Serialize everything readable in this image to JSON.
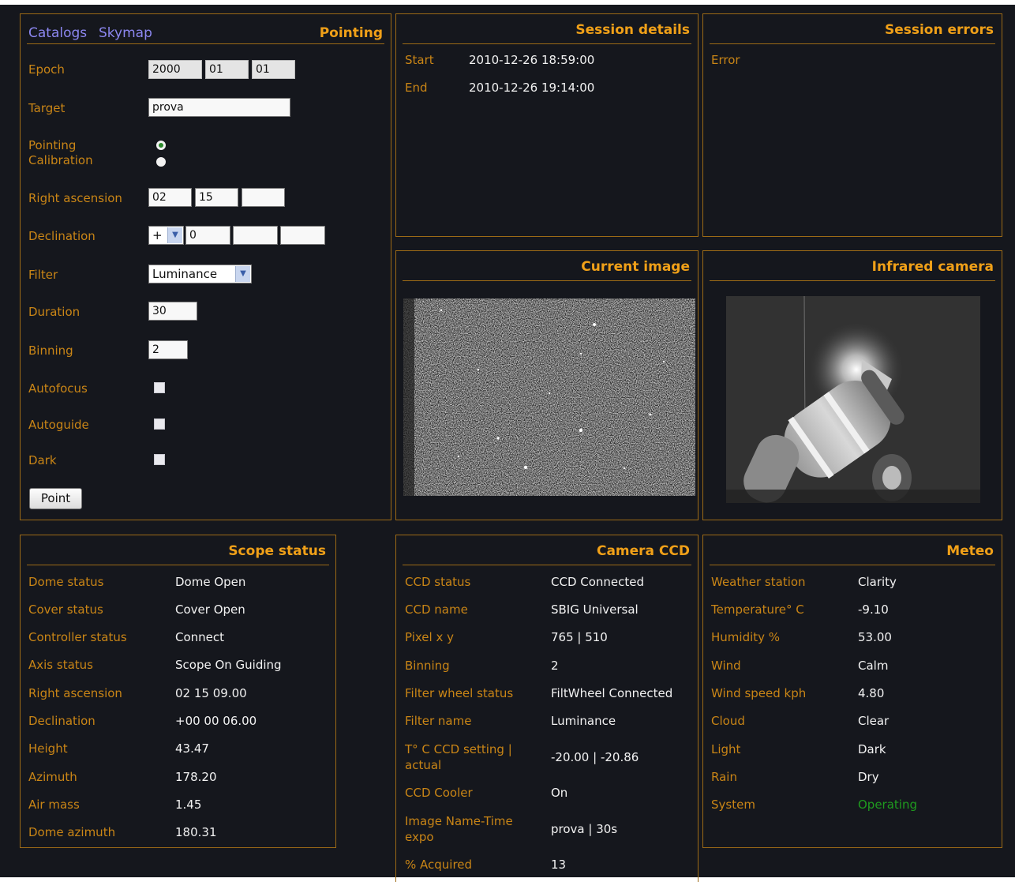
{
  "pointing": {
    "title": "Pointing",
    "nav": {
      "catalogs": "Catalogs",
      "skymap": "Skymap"
    },
    "epoch": {
      "label": "Epoch",
      "year": "2000",
      "month": "01",
      "day": "01"
    },
    "target": {
      "label": "Target",
      "value": "prova"
    },
    "mode": {
      "pointing_label": "Pointing",
      "calibration_label": "Calibration",
      "selected": "Pointing"
    },
    "right_ascension": {
      "label": "Right ascension",
      "h": "02",
      "m": "15",
      "s": ""
    },
    "declination": {
      "label": "Declination",
      "sign": "+",
      "d": "0",
      "m": "",
      "s": ""
    },
    "filter": {
      "label": "Filter",
      "value": "Luminance"
    },
    "duration": {
      "label": "Duration",
      "value": "30"
    },
    "binning": {
      "label": "Binning",
      "value": "2"
    },
    "autofocus": {
      "label": "Autofocus",
      "checked": false
    },
    "autoguide": {
      "label": "Autoguide",
      "checked": false
    },
    "dark": {
      "label": "Dark",
      "checked": false
    },
    "point_button": "Point"
  },
  "session_details": {
    "title": "Session details",
    "rows": [
      {
        "label": "Start",
        "value": "2010-12-26 18:59:00"
      },
      {
        "label": "End",
        "value": "2010-12-26 19:14:00"
      }
    ]
  },
  "session_errors": {
    "title": "Session errors",
    "label": "Error"
  },
  "current_image": {
    "title": "Current image"
  },
  "infrared_camera": {
    "title": "Infrared camera"
  },
  "scope_status": {
    "title": "Scope status",
    "rows": [
      {
        "label": "Dome status",
        "value": "Dome Open"
      },
      {
        "label": "Cover status",
        "value": "Cover Open"
      },
      {
        "label": "Controller status",
        "value": "Connect"
      },
      {
        "label": "Axis status",
        "value": "Scope On Guiding"
      },
      {
        "label": "Right ascension",
        "value": "02 15 09.00"
      },
      {
        "label": "Declination",
        "value": "+00 00 06.00"
      },
      {
        "label": "Height",
        "value": "43.47"
      },
      {
        "label": "Azimuth",
        "value": "178.20"
      },
      {
        "label": "Air mass",
        "value": "1.45"
      },
      {
        "label": "Dome azimuth",
        "value": "180.31"
      }
    ]
  },
  "camera_ccd": {
    "title": "Camera CCD",
    "rows": [
      {
        "label": "CCD status",
        "value": "CCD Connected"
      },
      {
        "label": "CCD name",
        "value": "SBIG Universal"
      },
      {
        "label": "Pixel x y",
        "value": "765 | 510"
      },
      {
        "label": "Binning",
        "value": "2"
      },
      {
        "label": "Filter wheel status",
        "value": "FiltWheel Connected"
      },
      {
        "label": "Filter name",
        "value": "Luminance"
      },
      {
        "label": "T° C CCD setting | actual",
        "value": "-20.00 | -20.86"
      },
      {
        "label": "CCD Cooler",
        "value": "On"
      },
      {
        "label": "Image Name-Time expo",
        "value": "prova | 30s"
      },
      {
        "label": "% Acquired",
        "value": "13"
      }
    ]
  },
  "meteo": {
    "title": "Meteo",
    "rows": [
      {
        "label": "Weather station",
        "value": "Clarity"
      },
      {
        "label": "Temperature° C",
        "value": "-9.10"
      },
      {
        "label": "Humidity %",
        "value": "53.00"
      },
      {
        "label": "Wind",
        "value": "Calm"
      },
      {
        "label": "Wind speed kph",
        "value": "4.80"
      },
      {
        "label": "Cloud",
        "value": "Clear"
      },
      {
        "label": "Light",
        "value": "Dark"
      },
      {
        "label": "Rain",
        "value": "Dry"
      },
      {
        "label": "System",
        "value": "Operating"
      }
    ]
  },
  "colors": {
    "accent": "#f0a018",
    "label": "#c98516",
    "link": "#8c87f0",
    "operating": "#1f9a1f",
    "background": "#15171d"
  }
}
